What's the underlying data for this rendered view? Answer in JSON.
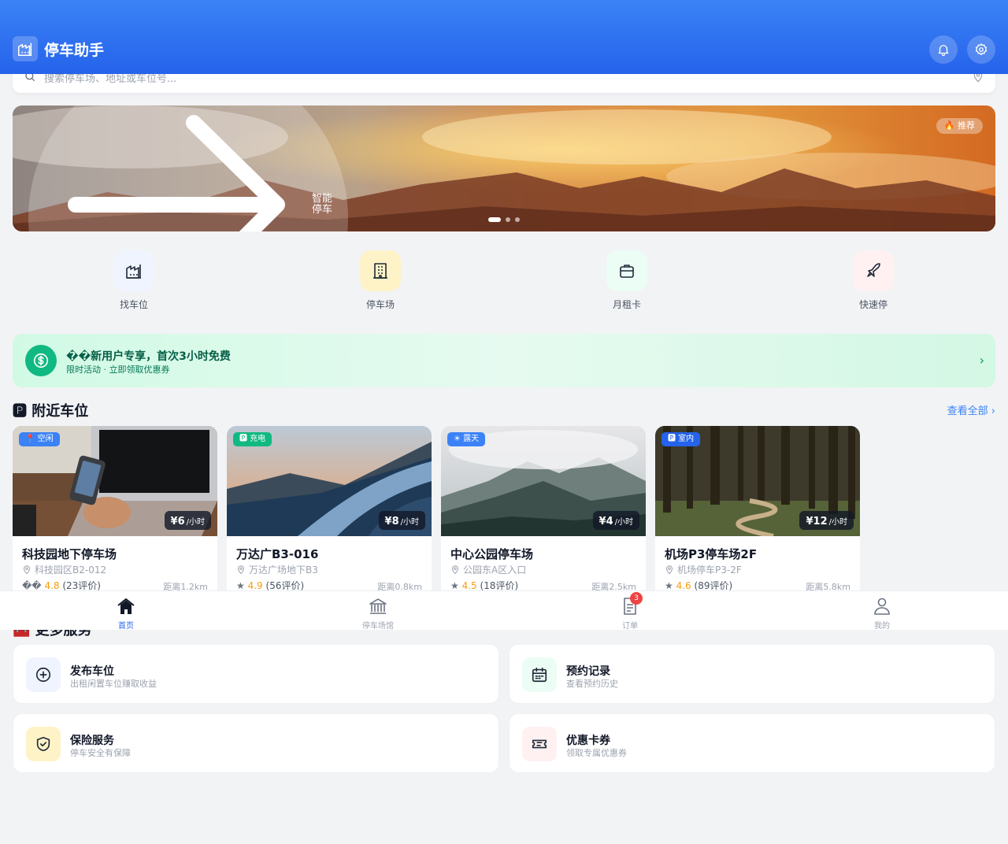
{
  "header": {
    "app_name": "停车助手"
  },
  "search": {
    "placeholder": "搜索停车场、地址或车位号..."
  },
  "banner": {
    "caption": "智能停车",
    "tag": "🔥 推荐"
  },
  "quick_actions": [
    {
      "label": "找车位",
      "icon": "parking-building-icon"
    },
    {
      "label": "停车场",
      "icon": "building-icon"
    },
    {
      "label": "月租卡",
      "icon": "briefcase-icon"
    },
    {
      "label": "快速停",
      "icon": "rocket-icon"
    }
  ],
  "promo": {
    "title": "��新用户专享，首次3小时免费",
    "subtitle": "限时活动 · 立即领取优惠券"
  },
  "section_nearby": {
    "title": "🅿 附近车位",
    "more": "查看全部 ›"
  },
  "cards": [
    {
      "badge": "📍 空闲",
      "badge_color": "#3b82f6",
      "price": "¥6",
      "unit": "/小时",
      "name": "科技园地下停车场",
      "location": "科技园区B2-012",
      "star": "��",
      "rating": "4.8",
      "reviews": "(23评价)",
      "distance": "距离1.2km"
    },
    {
      "badge": "🅿 充电",
      "badge_color": "#10b981",
      "price": "¥8",
      "unit": "/小时",
      "name": "万达广B3-016",
      "location": "万达广场地下B3",
      "star": "★",
      "rating": "4.9",
      "reviews": "(56评价)",
      "distance": "距离0.8km"
    },
    {
      "badge": "☀ 露天",
      "badge_color": "#3b82f6",
      "price": "¥4",
      "unit": "/小时",
      "name": "中心公园停车场",
      "location": "公园东A区入口",
      "star": "★",
      "rating": "4.5",
      "reviews": "(18评价)",
      "distance": "距离2.5km"
    },
    {
      "badge": "🅿 室内",
      "badge_color": "#2563eb",
      "price": "¥12",
      "unit": "/小时",
      "name": "机场P3停车场2F",
      "location": "机场停车P3-2F",
      "star": "★",
      "rating": "4.6",
      "reviews": "(89评价)",
      "distance": "距离5.8km"
    }
  ],
  "section_services": {
    "title": "🧰 更多服务"
  },
  "services": [
    {
      "title": "发布车位",
      "subtitle": "出租闲置车位赚取收益",
      "icon": "plus-circle-icon"
    },
    {
      "title": "预约记录",
      "subtitle": "查看预约历史",
      "icon": "calendar-icon"
    },
    {
      "title": "保险服务",
      "subtitle": "停车安全有保障",
      "icon": "shield-check-icon"
    },
    {
      "title": "优惠卡券",
      "subtitle": "领取专属优惠券",
      "icon": "ticket-icon"
    }
  ],
  "tabbar": [
    {
      "label": "首页",
      "icon": "home-icon"
    },
    {
      "label": "停车场馆",
      "icon": "bank-icon"
    },
    {
      "label": "订单",
      "icon": "document-icon",
      "badge": "3"
    },
    {
      "label": "我的",
      "icon": "user-icon"
    }
  ]
}
